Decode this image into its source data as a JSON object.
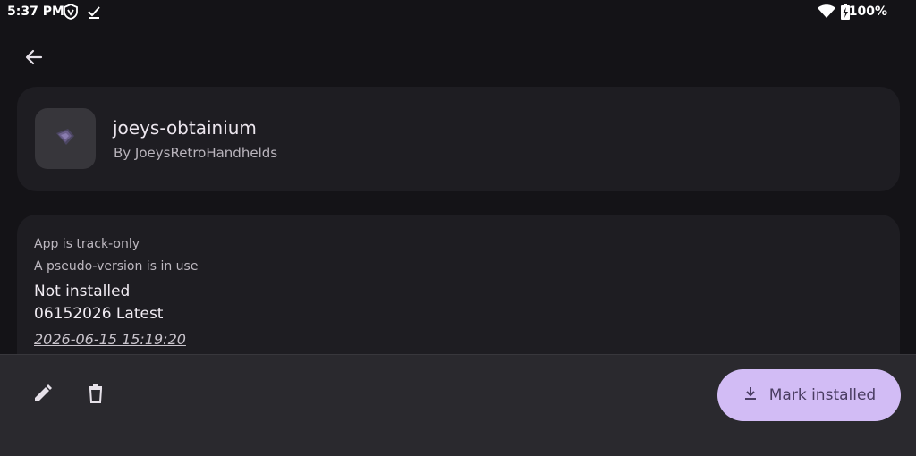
{
  "status_bar": {
    "time": "5:37 PM",
    "battery": "100%",
    "icons": [
      "vpn-shield-icon",
      "check-icon",
      "wifi-icon",
      "battery-charging-icon"
    ]
  },
  "header": {
    "back_icon": "arrow-left-icon"
  },
  "app": {
    "name": "joeys-obtainium",
    "author": "By JoeysRetroHandhelds",
    "icon": "app-logo-icon"
  },
  "info": {
    "track_only": "App is track-only",
    "pseudo_version": "A pseudo-version is in use",
    "install_status": "Not installed",
    "version": "06152026 Latest",
    "release_date": "2026-06-15 15:19:20"
  },
  "bottom_bar": {
    "edit_icon": "pencil-icon",
    "delete_icon": "trash-icon",
    "primary_label": "Mark installed",
    "primary_icon": "download-icon"
  },
  "colors": {
    "background": "#141317",
    "card": "#1e1d22",
    "bottom_bar": "#2a292e",
    "accent_button": "#d2bcf5",
    "accent_text": "#4a3d62"
  }
}
